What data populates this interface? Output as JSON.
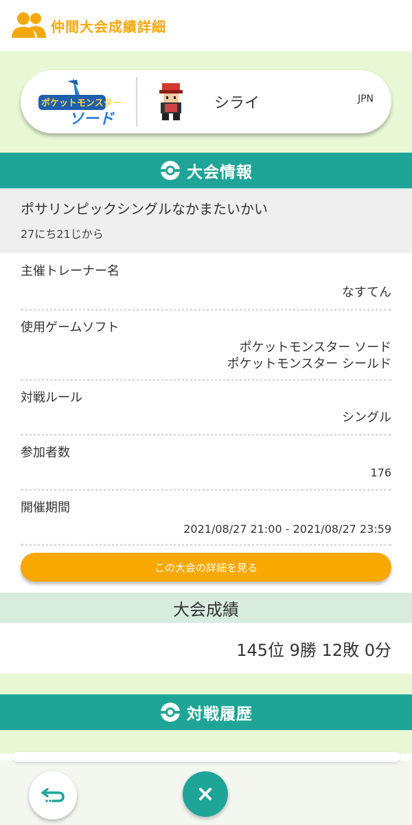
{
  "header": {
    "title": "仲間大会成績詳細",
    "icon": "friends-icon",
    "accent": "#f4a80c"
  },
  "profile": {
    "game_logo_lines": [
      "ポケットモンスター",
      "ソード"
    ],
    "trainer_name": "シライ",
    "region": "JPN"
  },
  "tournament_info": {
    "section_title": "大会情報",
    "event_name": "ポサリンピックシングルなかまたいかい",
    "event_subtitle": "27にち21じから",
    "rows": [
      {
        "label": "主催トレーナー名",
        "value": "なすてん"
      },
      {
        "label": "使用ゲームソフト",
        "value_lines": [
          "ポケットモンスター ソード",
          "ポケットモンスター シールド"
        ]
      },
      {
        "label": "対戦ルール",
        "value": "シングル"
      },
      {
        "label": "参加者数",
        "value": "176"
      },
      {
        "label": "開催期間",
        "value": "2021/08/27 21:00 - 2021/08/27 23:59"
      }
    ],
    "detail_button": "この大会の詳細を見る"
  },
  "results": {
    "title": "大会成績",
    "value": "145位 9勝 12敗 0分"
  },
  "battle_history": {
    "section_title": "対戦履歴"
  },
  "bottom_nav": {
    "back_icon": "back-arrow-icon",
    "close_icon": "close-icon"
  },
  "colors": {
    "teal": "#1fa598",
    "orange": "#f9a800",
    "light_green": "#e8f8d4",
    "results_header": "#d8ecdf"
  }
}
